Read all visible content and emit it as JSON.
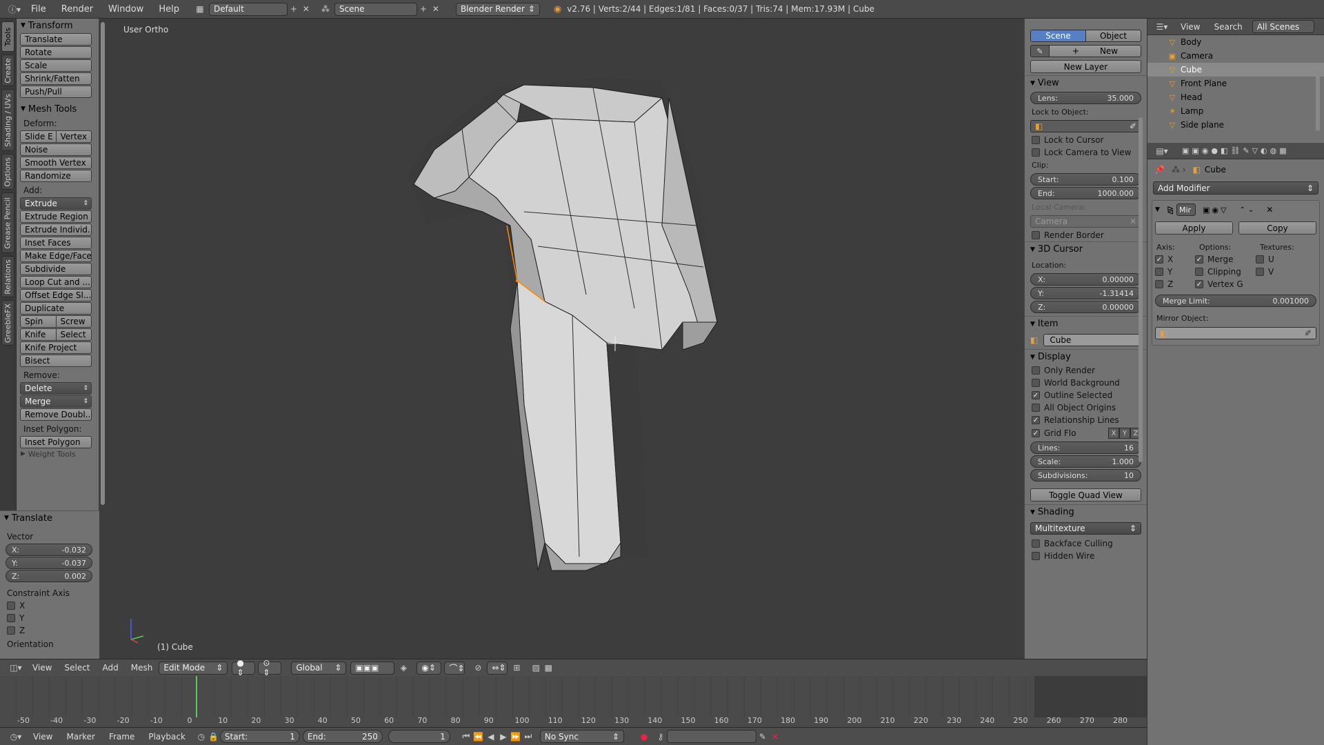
{
  "topbar": {
    "menus": [
      "File",
      "Render",
      "Window",
      "Help"
    ],
    "layout": "Default",
    "scene": "Scene",
    "engine": "Blender Render",
    "stats": "v2.76 | Verts:2/44 | Edges:1/81 | Faces:0/37 | Tris:74 | Mem:17.93M | Cube"
  },
  "lefttabs": [
    "Tools",
    "Create",
    "Shading / UVs",
    "Options",
    "Grease Pencil",
    "Relations",
    "GreebleFX"
  ],
  "toolshelf": {
    "transform_title": "Transform",
    "transform_buttons": [
      "Translate",
      "Rotate",
      "Scale",
      "Shrink/Fatten",
      "Push/Pull"
    ],
    "meshtools_title": "Mesh Tools",
    "deform_label": "Deform:",
    "slide_e": "Slide E",
    "vertex": "Vertex",
    "noise": "Noise",
    "smooth_vertex": "Smooth Vertex",
    "randomize": "Randomize",
    "add_label": "Add:",
    "extrude": "Extrude",
    "extrude_region": "Extrude Region",
    "extrude_individual": "Extrude Individ...",
    "inset_faces": "Inset Faces",
    "make_edge_face": "Make Edge/Face",
    "subdivide": "Subdivide",
    "loop_cut": "Loop Cut and ...",
    "offset_edge": "Offset Edge Sl...",
    "duplicate": "Duplicate",
    "spin": "Spin",
    "screw": "Screw",
    "knife": "Knife",
    "select": "Select",
    "knife_project": "Knife Project",
    "bisect": "Bisect",
    "remove_label": "Remove:",
    "delete": "Delete",
    "merge": "Merge",
    "remove_doubles": "Remove Doubl...",
    "inset_polygon_label": "Inset Polygon:",
    "inset_polygon": "Inset Polygon",
    "weight_tools": "Weight Tools"
  },
  "operator": {
    "title": "Translate",
    "vector_label": "Vector",
    "x_label": "X:",
    "x": "-0.032",
    "y_label": "Y:",
    "y": "-0.037",
    "z_label": "Z:",
    "z": "0.002",
    "constraint_label": "Constraint Axis",
    "cx": "X",
    "cy": "Y",
    "cz": "Z",
    "orientation_label": "Orientation"
  },
  "viewport": {
    "view_name": "User Ortho",
    "object_label": "(1) Cube"
  },
  "vpbar": {
    "menus": [
      "View",
      "Select",
      "Add",
      "Mesh"
    ],
    "mode": "Edit Mode",
    "orientation": "Global"
  },
  "propshelf": {
    "scene_tab": "Scene",
    "object_tab": "Object",
    "new_btn": "New",
    "new_layer": "New Layer",
    "view_title": "View",
    "lens_label": "Lens:",
    "lens": "35.000",
    "lock_to_object": "Lock to Object:",
    "lock_to_cursor": "Lock to Cursor",
    "lock_camera": "Lock Camera to View",
    "clip_label": "Clip:",
    "start_label": "Start:",
    "start": "0.100",
    "end_label": "End:",
    "end": "1000.000",
    "local_camera": "Local Camera:",
    "camera": "Camera",
    "render_border": "Render Border",
    "cursor_title": "3D Cursor",
    "location_label": "Location:",
    "cx_label": "X:",
    "cx": "0.00000",
    "cy_label": "Y:",
    "cy": "-1.31414",
    "cz_label": "Z:",
    "cz": "0.00000",
    "item_title": "Item",
    "item_name": "Cube",
    "display_title": "Display",
    "only_render": "Only Render",
    "world_background": "World Background",
    "outline_selected": "Outline Selected",
    "all_object_origins": "All Object Origins",
    "relationship_lines": "Relationship Lines",
    "grid_floor": "Grid Flo",
    "gx": "X",
    "gy": "Y",
    "gz": "Z",
    "lines_label": "Lines:",
    "lines": "16",
    "scale_label": "Scale:",
    "scale": "1.000",
    "subdiv_label": "Subdivisions:",
    "subdiv": "10",
    "toggle_quad": "Toggle Quad View",
    "shading_title": "Shading",
    "shading_mode": "Multitexture",
    "backface": "Backface Culling",
    "hidden_wire": "Hidden Wire"
  },
  "outliner": {
    "view": "View",
    "search": "Search",
    "scenes": "All Scenes",
    "items": [
      "Body",
      "Camera",
      "Cube",
      "Front Plane",
      "Head",
      "Lamp",
      "Side plane"
    ]
  },
  "props": {
    "breadcrumb": "Cube",
    "add_modifier": "Add Modifier",
    "mod_name": "Mir",
    "apply": "Apply",
    "copy": "Copy",
    "axis_label": "Axis:",
    "options_label": "Options:",
    "textures_label": "Textures:",
    "ax": "X",
    "ay": "Y",
    "az": "Z",
    "merge": "Merge",
    "clipping": "Clipping",
    "vertex_g": "Vertex G",
    "tu": "U",
    "tv": "V",
    "merge_limit_label": "Merge Limit:",
    "merge_limit": "0.001000",
    "mirror_object": "Mirror Object:"
  },
  "timeline": {
    "ticks": [
      "-50",
      "-40",
      "-30",
      "-20",
      "-10",
      "0",
      "10",
      "20",
      "30",
      "40",
      "50",
      "60",
      "70",
      "80",
      "90",
      "100",
      "110",
      "120",
      "130",
      "140",
      "150",
      "160",
      "170",
      "180",
      "190",
      "200",
      "210",
      "220",
      "230",
      "240",
      "250",
      "260",
      "270",
      "280"
    ],
    "menus": [
      "View",
      "Marker",
      "Frame",
      "Playback"
    ],
    "start_label": "Start:",
    "start": "1",
    "end_label": "End:",
    "end": "250",
    "current": "1",
    "sync": "No Sync"
  }
}
